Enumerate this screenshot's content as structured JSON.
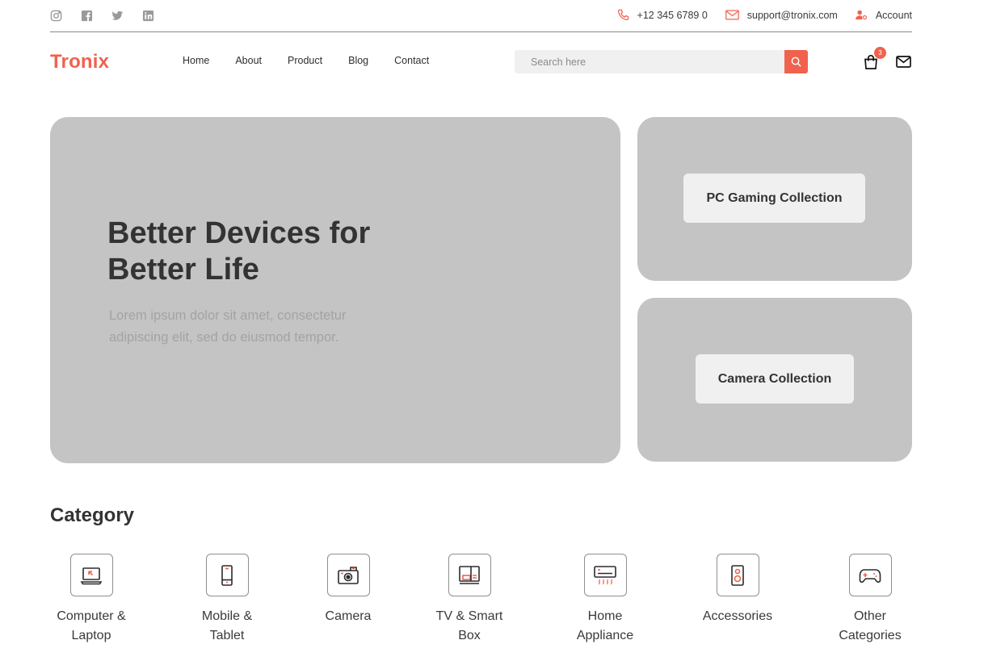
{
  "colors": {
    "accent": "#f0624d",
    "placeholder_block": "#c4c4c4",
    "text_dark": "#333333",
    "button_bg": "#f0f0f0"
  },
  "topbar": {
    "social": [
      "instagram-icon",
      "facebook-icon",
      "twitter-icon",
      "linkedin-icon"
    ],
    "phone": "+12 345 6789 0",
    "email": "support@tronix.com",
    "account": "Account"
  },
  "header": {
    "logo": "Tronix",
    "nav": [
      "Home",
      "About",
      "Product",
      "Blog",
      "Contact"
    ],
    "search_placeholder": "Search here",
    "cart_count": "3"
  },
  "hero": {
    "title_line1": "Better Devices for",
    "title_line2": "Better Life",
    "subtitle_line1": "Lorem ipsum dolor sit amet, consectetur",
    "subtitle_line2": "adipiscing elit, sed do eiusmod tempor."
  },
  "promos": [
    {
      "label": "PC Gaming Collection"
    },
    {
      "label": "Camera Collection"
    }
  ],
  "category": {
    "title": "Category",
    "items": [
      {
        "line1": "Computer &",
        "line2": "Laptop",
        "icon": "laptop-icon"
      },
      {
        "line1": "Mobile &",
        "line2": "Tablet",
        "icon": "mobile-icon"
      },
      {
        "line1": "Camera",
        "line2": "",
        "icon": "camera-icon"
      },
      {
        "line1": "TV & Smart",
        "line2": "Box",
        "icon": "tv-icon"
      },
      {
        "line1": "Home",
        "line2": "Appliance",
        "icon": "air-conditioner-icon"
      },
      {
        "line1": "Accessories",
        "line2": "",
        "icon": "speaker-icon"
      },
      {
        "line1": "Other",
        "line2": "Categories",
        "icon": "gamepad-icon"
      }
    ]
  }
}
